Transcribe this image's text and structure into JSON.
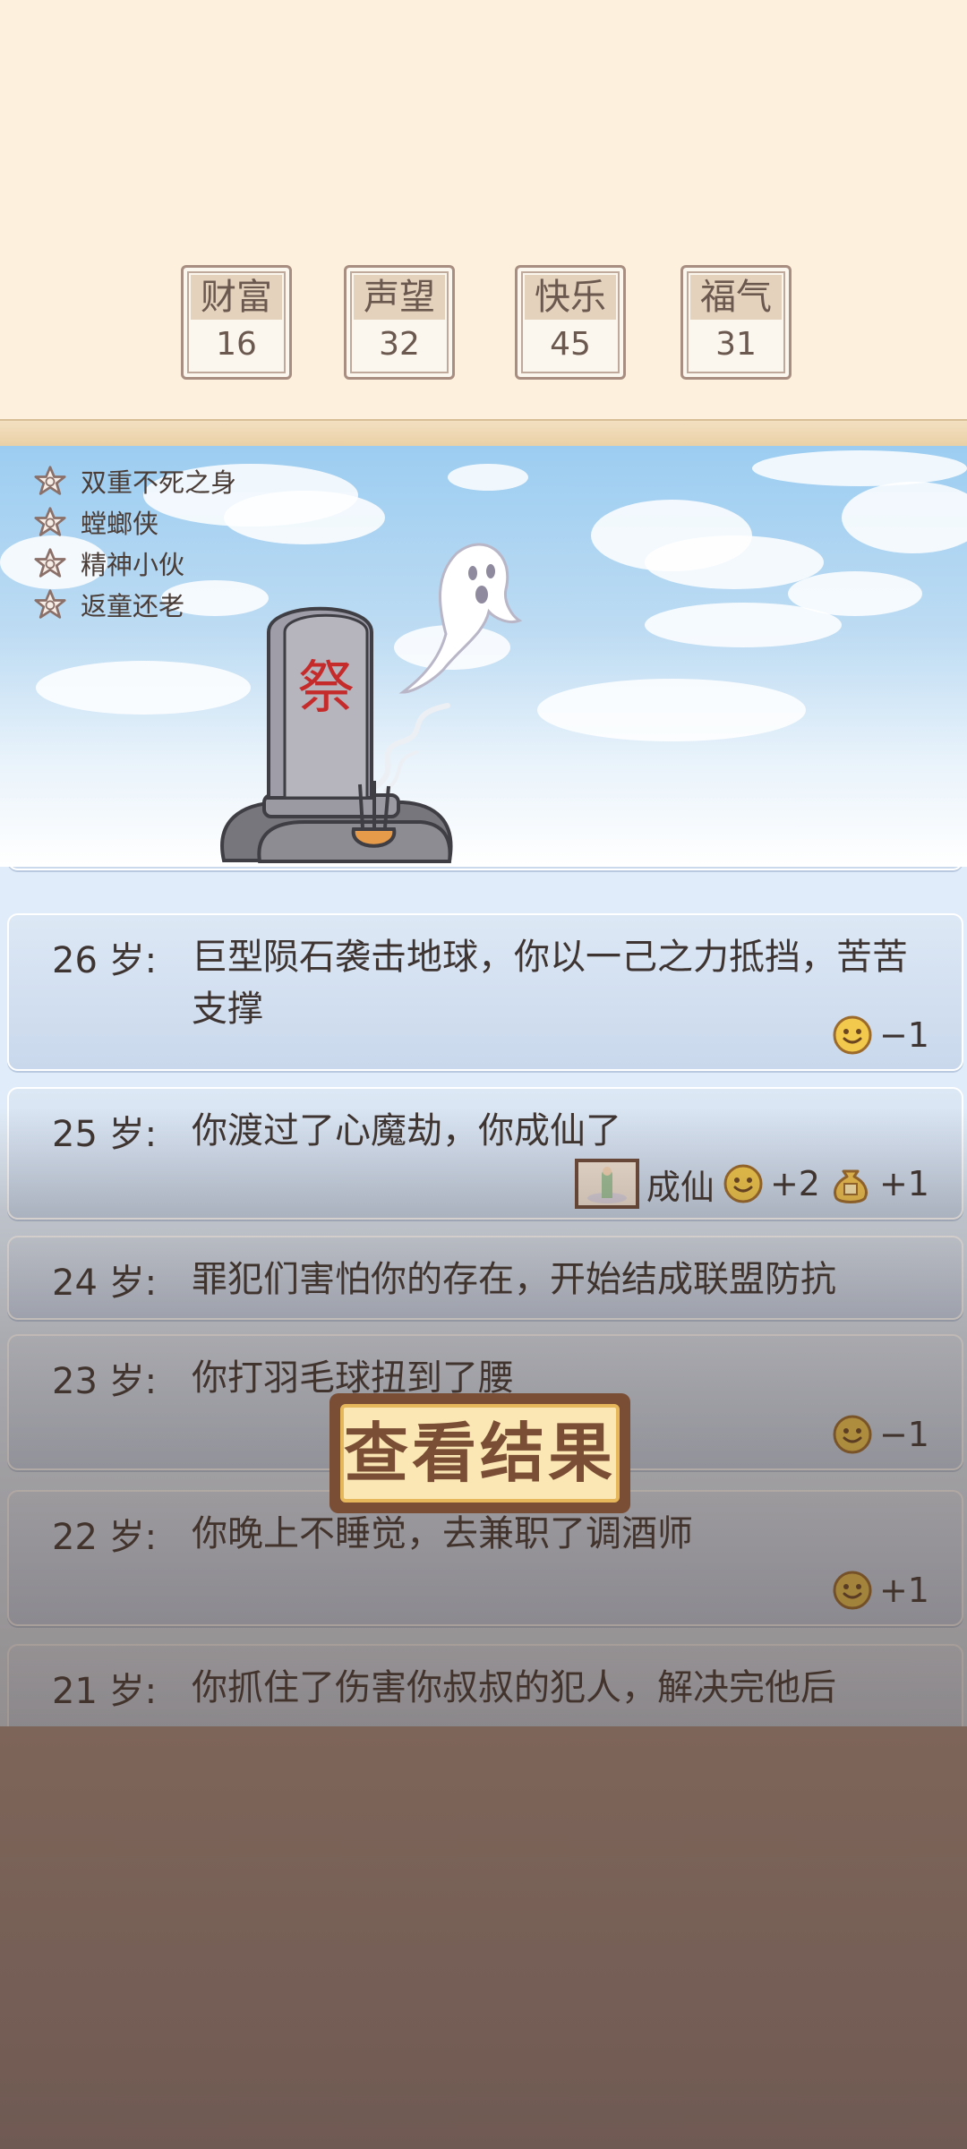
{
  "stats": [
    {
      "label": "财富",
      "value": "16"
    },
    {
      "label": "声望",
      "value": "32"
    },
    {
      "label": "快乐",
      "value": "45"
    },
    {
      "label": "福气",
      "value": "31"
    }
  ],
  "talents": [
    "双重不死之身",
    "螳螂侠",
    "精神小伙",
    "返童还老"
  ],
  "tombstone": {
    "character": "祭"
  },
  "events": [
    {
      "age": "26 岁:",
      "text": "巨型陨石袭击地球，你以一己之力抵挡，苦苦支撑",
      "effects": [
        {
          "icon": "smile-icon",
          "value": "−1"
        }
      ]
    },
    {
      "age": "25 岁:",
      "text": "你渡过了心魔劫，你成仙了",
      "badge": "成仙",
      "effects": [
        {
          "icon": "smile-icon",
          "value": "+2"
        },
        {
          "icon": "money-bag-icon",
          "value": "+1"
        }
      ]
    },
    {
      "age": "24 岁:",
      "text": "罪犯们害怕你的存在，开始结成联盟防抗",
      "effects": []
    },
    {
      "age": "23 岁:",
      "text": "你打羽毛球扭到了腰",
      "effects": [
        {
          "icon": "smile-icon",
          "value": "−1"
        }
      ]
    },
    {
      "age": "22 岁:",
      "text": "你晚上不睡觉，去兼职了调酒师",
      "effects": [
        {
          "icon": "smile-icon",
          "value": "+1"
        }
      ]
    },
    {
      "age": "21 岁:",
      "text": "你抓住了伤害你叔叔的犯人，解决完他后",
      "effects": []
    }
  ],
  "view_result_label": "查看结果"
}
